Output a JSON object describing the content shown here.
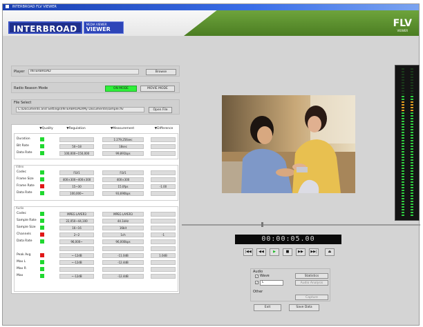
{
  "window": {
    "title": "INTERBROAD FLV VIEWER"
  },
  "logo": {
    "main": "INTERBROAD",
    "sub": "MEDIA VIEWER",
    "big": "VIEWER"
  },
  "brand": {
    "name": "FLV",
    "sub": "VIEWER"
  },
  "colors": {
    "accent_green": "#4b7d22",
    "ok": "#20d830",
    "error": "#e01818",
    "title_blue": "#1a3fb0"
  },
  "top": {
    "player_label": "Player",
    "player_value": "INTERBROAD",
    "browse_label": "Browse",
    "radio_label": "Radio Reason Mode",
    "mode_on": "ON MODE",
    "mode_off": "MOVIE MODE",
    "file_label": "File Select",
    "file_path": "C:\\Documents and Settings\\INTERBROAD\\My Documents\\sample.flv",
    "open_label": "Open File"
  },
  "analysis": {
    "headers": [
      "▼Quality",
      "▼Regulation",
      "▼Measurement",
      "▼Difference"
    ],
    "general": {
      "label": "",
      "rows": [
        {
          "name": "Duration",
          "status": "ok",
          "reg": "",
          "meas": "1:279,256sec",
          "diff": ""
        },
        {
          "name": "Bit Rate",
          "status": "ok",
          "reg": "50~18",
          "meas": "18sec",
          "diff": ""
        },
        {
          "name": "Data Rate",
          "status": "ok",
          "reg": "100,000~150,000",
          "meas": "99,891bps",
          "diff": ""
        }
      ]
    },
    "video": {
      "label": "Video",
      "rows": [
        {
          "name": "Codec",
          "status": "ok",
          "reg": "FLV1",
          "meas": "FLV1",
          "diff": ""
        },
        {
          "name": "Frame Size",
          "status": "ok",
          "reg": "400×300~400×300",
          "meas": "400×300",
          "diff": ""
        },
        {
          "name": "Frame Rate",
          "status": "err",
          "reg": "15~30",
          "meas": "15.0fps",
          "diff": "-1.00"
        },
        {
          "name": "Data Rate",
          "status": "ok",
          "reg": "100,000~",
          "meas": "93,690bps",
          "diff": ""
        }
      ]
    },
    "audio": {
      "label": "Audio",
      "rows": [
        {
          "name": "Codec",
          "status": "ok",
          "reg": "MPEG LAYER3",
          "meas": "MPEG LAYER3",
          "diff": ""
        },
        {
          "name": "Sample Rate",
          "status": "ok",
          "reg": "22,050~44,100",
          "meas": "44.1kHz",
          "diff": ""
        },
        {
          "name": "Sample Size",
          "status": "ok",
          "reg": "16~16",
          "meas": "16bit",
          "diff": ""
        },
        {
          "name": "Channels",
          "status": "err",
          "reg": "2~2",
          "meas": "1ch",
          "diff": "-1"
        },
        {
          "name": "Data Rate",
          "status": "ok",
          "reg": "96,000~",
          "meas": "96,000bps",
          "diff": ""
        },
        {
          "name": "",
          "status": "none",
          "reg": "",
          "meas": "",
          "diff": ""
        },
        {
          "name": "Peak Avg",
          "status": "err",
          "reg": "~-12dB",
          "meas": "-11.0dB",
          "diff": "1.0dB"
        },
        {
          "name": "Max L",
          "status": "ok",
          "reg": "~-12dB",
          "meas": "-12.4dB",
          "diff": ""
        },
        {
          "name": "Max R",
          "status": "ok",
          "reg": "",
          "meas": "",
          "diff": ""
        },
        {
          "name": "Max",
          "status": "ok",
          "reg": "~-12dB",
          "meas": "-12.4dB",
          "diff": ""
        }
      ]
    }
  },
  "player": {
    "timecode": "00:00:05.00"
  },
  "transport": [
    "|◀◀",
    "◀◀",
    "▶",
    "■",
    "▶▶",
    "▶▶|",
    "⏏"
  ],
  "options": {
    "audio_label": "Audio",
    "opt1_label": "Wave",
    "opt1_checked": true,
    "opt2_label": "L",
    "opt2_checked": true,
    "select_value": "L",
    "btn_a": "Statistics",
    "btn_b": "Audio Analysis",
    "other_label": "Other",
    "btn_c": "Capture",
    "exit": "Exit",
    "save": "Save Data"
  },
  "vu": {
    "left_level": 0.82,
    "right_level": 0.82,
    "peak_color": "#e8a020"
  }
}
